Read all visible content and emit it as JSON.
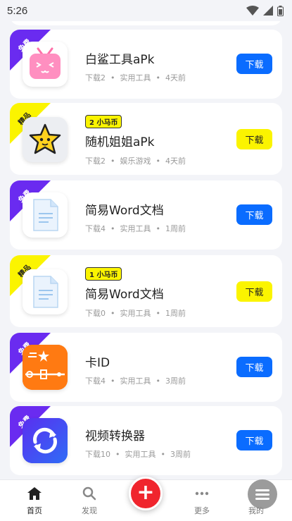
{
  "status_bar": {
    "time": "5:26"
  },
  "apps": [
    {
      "name": "白鲨工具aPk",
      "badge": "免费",
      "badge_color": "#6a2bf0",
      "coin": "",
      "downloads": "下载2",
      "category": "实用工具",
      "time": "4天前",
      "button": "下载",
      "button_color": "#0a6cff",
      "icon": "pink-tv-mascot-icon"
    },
    {
      "name": "随机姐姐aPk",
      "badge": "精品",
      "badge_color": "#fbf400",
      "coin": "2 小马币",
      "downloads": "下载2",
      "category": "娱乐游戏",
      "time": "4天前",
      "button": "下载",
      "button_color": "#fbf400",
      "icon": "star-face-icon"
    },
    {
      "name": "简易Word文档",
      "badge": "免费",
      "badge_color": "#6a2bf0",
      "coin": "",
      "downloads": "下载4",
      "category": "实用工具",
      "time": "1周前",
      "button": "下载",
      "button_color": "#0a6cff",
      "icon": "document-icon"
    },
    {
      "name": "简易Word文档",
      "badge": "精品",
      "badge_color": "#fbf400",
      "coin": "1 小马币",
      "downloads": "下载0",
      "category": "实用工具",
      "time": "1周前",
      "button": "下载",
      "button_color": "#fbf400",
      "icon": "document-icon"
    },
    {
      "name": "卡ID",
      "badge": "免费",
      "badge_color": "#6a2bf0",
      "coin": "",
      "downloads": "下载4",
      "category": "实用工具",
      "time": "3周前",
      "button": "下载",
      "button_color": "#0a6cff",
      "icon": "orange-card-icon"
    },
    {
      "name": "视频转换器",
      "badge": "免费",
      "badge_color": "#6a2bf0",
      "coin": "",
      "downloads": "下载10",
      "category": "实用工具",
      "time": "3周前",
      "button": "下载",
      "button_color": "#0a6cff",
      "icon": "convert-arrows-icon"
    }
  ],
  "meta_separator": "•",
  "nav": {
    "home": "首页",
    "discover": "发现",
    "add": "+",
    "more": "更多",
    "mine": "我的"
  }
}
